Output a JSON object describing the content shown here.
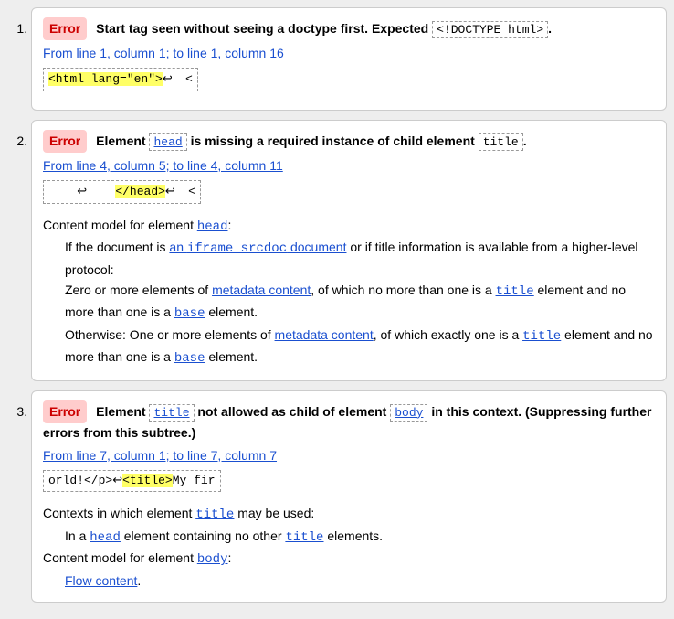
{
  "items": [
    {
      "badge": "Error",
      "msg_before": "Start tag seen without seeing a doctype first. Expected ",
      "msg_code": "<!DOCTYPE html>",
      "msg_after": ".",
      "loc": "From line 1, column 1; to line 1, column 16",
      "extract_pre": "",
      "extract_hl": "<html lang=\"en\">",
      "extract_post": "↩    <"
    },
    {
      "badge": "Error",
      "msg_p1": "Element ",
      "msg_code1": "head",
      "msg_p2": " is missing a required instance of child element ",
      "msg_code2": "title",
      "msg_p3": ".",
      "loc": "From line 4, column 5; to line 4, column 11",
      "extract_pre": "    ↩    ",
      "extract_hl": "</head>",
      "extract_post": "↩    <",
      "cm_label_pre": "Content model for element ",
      "cm_label_link": "head",
      "cm_label_post": ":",
      "line1_a": "If the document is ",
      "line1_link1_pre": "an ",
      "line1_link1_code": "iframe srcdoc",
      "line1_link1_post": " document",
      "line1_b": " or if title information is available from a higher-level protocol:",
      "line2_a": "Zero or more elements of ",
      "line2_link": "metadata content",
      "line2_b": ", of which no more than one is a ",
      "line2_code1": "title",
      "line2_c": " element and no more than one is a ",
      "line2_code2": "base",
      "line2_d": " element.",
      "line3_a": "Otherwise: One or more elements of ",
      "line3_link": "metadata content",
      "line3_b": ", of which exactly one is a ",
      "line3_code1": "title",
      "line3_c": " element and no more than one is a ",
      "line3_code2": "base",
      "line3_d": " element."
    },
    {
      "badge": "Error",
      "m_a": "Element ",
      "m_code1": "title",
      "m_b": " not allowed as child of element ",
      "m_code2": "body",
      "m_c": " in this context. (Suppressing further errors from this subtree.)",
      "loc": "From line 7, column 1; to line 7, column 7",
      "extract_pre": "orld!</p>↩",
      "extract_hl": "<title>",
      "extract_post": "My fir",
      "ctx_label_a": "Contexts in which element ",
      "ctx_label_link": "title",
      "ctx_label_b": " may be used:",
      "ctx_line_a": "In a ",
      "ctx_line_code1": "head",
      "ctx_line_b": " element containing no other ",
      "ctx_line_code2": "title",
      "ctx_line_c": " elements.",
      "cm_label_a": "Content model for element ",
      "cm_label_link": "body",
      "cm_label_b": ":",
      "cm_line_link": "Flow content",
      "cm_line_b": "."
    }
  ]
}
